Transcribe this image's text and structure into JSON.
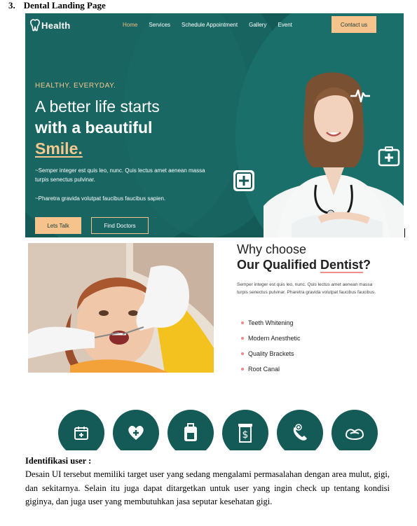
{
  "doc": {
    "number": "3.",
    "title": "Dental Landing Page"
  },
  "hero": {
    "logo_text": "Health",
    "nav": [
      "Home",
      "Services",
      "Schedule Appointment",
      "Gallery",
      "Event"
    ],
    "active_nav": "Home",
    "contact_label": "Contact us",
    "eyebrow": "HEALTHY. EVERYDAY.",
    "headline_line1": "A better life starts",
    "headline_line2": "with a beautiful",
    "headline_line3": "Smile.",
    "desc1": "~Semper integer est quis leo, nunc. Quis lectus amet aenean massa turpis senectus pulvinar.",
    "desc2": "~Pharetra gravida volutpat faucibus faucibus sapien.",
    "btn_talk": "Lets Talk",
    "btn_find": "Find Doctors",
    "colors": {
      "bg": "#145b57",
      "accent": "#f7c38c"
    }
  },
  "why": {
    "title_line1": "Why choose",
    "title_prefix": "Our Qualified ",
    "title_highlight": "Dentist",
    "title_suffix": "?",
    "description": "Semper integer est quis leo, nunc. Quis lectus amet aenean massa turpis senectus pulvinar. Pharetra gravida volutpat faucibus faucibus.",
    "items": [
      "Teeth Whitening",
      "Modern Anesthetic",
      "Quality Brackets",
      "Root Canal"
    ]
  },
  "services": {
    "icons": [
      "calendar-plus-icon",
      "heart-plus-icon",
      "medical-kit-icon",
      "bill-icon",
      "phone-icon",
      "handshake-icon"
    ]
  },
  "identification": {
    "title": "Identifikasi user :",
    "body": "Desain UI tersebut memiliki target user yang sedang mengalami permasalahan dengan area mulut, gigi, dan sekitarnya. Selain itu juga dapat ditargetkan untuk user yang ingin check up tentang kondisi giginya, dan juga user yang membutuhkan jasa seputar kesehatan gigi."
  }
}
